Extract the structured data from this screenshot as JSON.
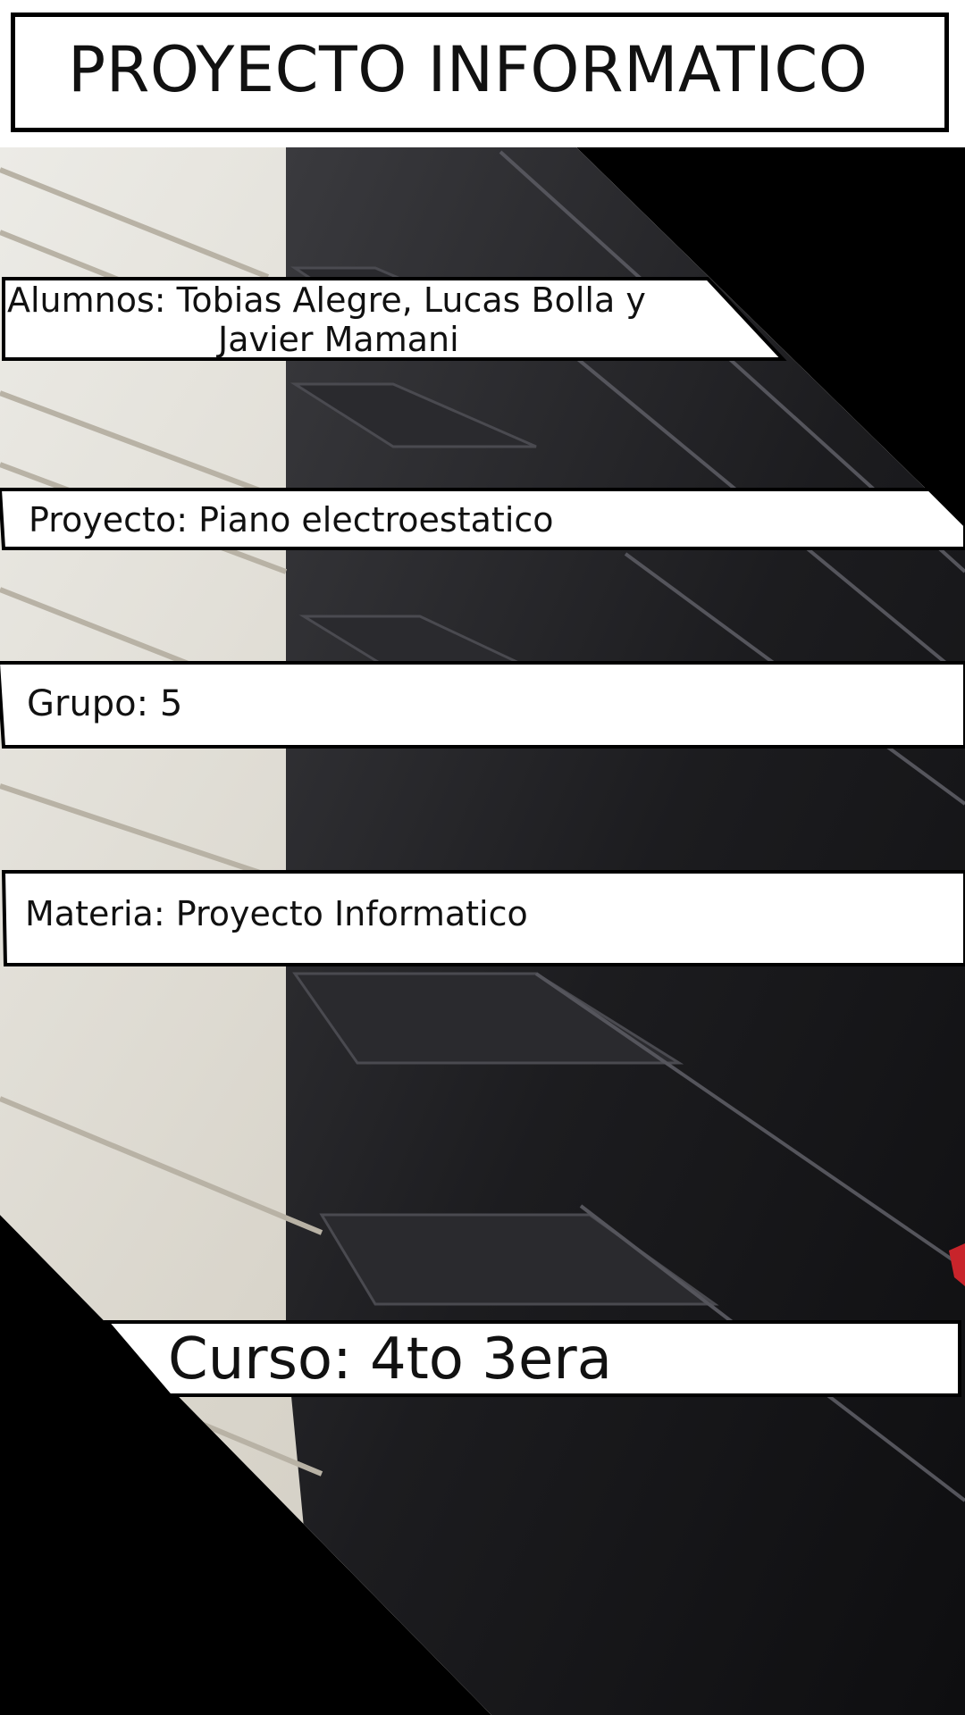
{
  "title": "PROYECTO INFORMATICO",
  "alumnos_line1": "Alumnos: Tobias Alegre, Lucas Bolla y",
  "alumnos_line2": "Javier Mamani",
  "proyecto": "Proyecto: Piano electroestatico",
  "grupo": "Grupo: 5",
  "materia": "Materia: Proyecto Informatico",
  "curso": "Curso: 4to 3era",
  "colors": {
    "background": "#ffffff",
    "frame": "#000000",
    "piano_white_keys": "#e6e2d8",
    "piano_black_keys": "#1c1c1f"
  }
}
